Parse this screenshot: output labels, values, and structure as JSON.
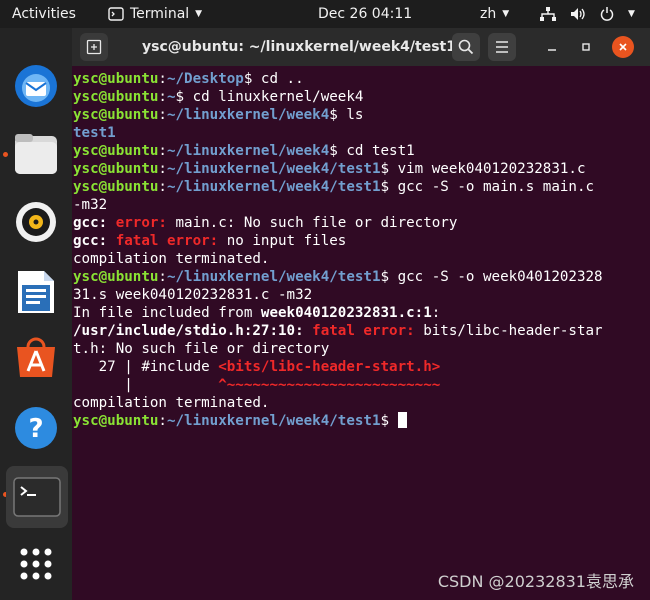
{
  "topbar": {
    "activities": "Activities",
    "app_name": "Terminal",
    "clock": "Dec 26  04:11",
    "lang": "zh"
  },
  "dock": {
    "items": [
      "thunderbird-icon",
      "files-icon",
      "rhythmbox-icon",
      "writer-icon",
      "app-center-icon",
      "help-icon",
      "terminal-icon",
      "app-grid-icon"
    ]
  },
  "window": {
    "title": "ysc@ubuntu: ~/linuxkernel/week4/test1"
  },
  "terminal": {
    "user": "ysc@ubuntu",
    "lines": [
      {
        "path": "~/Desktop",
        "cmd": " cd .."
      },
      {
        "path": "~",
        "cmd": " cd linuxkernel/week4"
      },
      {
        "path": "~/linuxkernel/week4",
        "cmd": " ls"
      },
      {
        "text": "test1"
      },
      {
        "path": "~/linuxkernel/week4",
        "cmd": " cd test1"
      },
      {
        "path": "~/linuxkernel/week4/test1",
        "cmd": " vim week040120232831.c"
      },
      {
        "path": "~/linuxkernel/week4/test1",
        "cmd": " gcc -S -o main.s main.c"
      },
      {
        "text": "-m32"
      },
      {
        "a": "gcc:",
        "b": "error:",
        "c": " main.c: No such file or directory"
      },
      {
        "a": "gcc:",
        "b": "fatal error:",
        "c": " no input files"
      },
      {
        "text": "compilation terminated."
      },
      {
        "path": "~/linuxkernel/week4/test1",
        "cmd": " gcc -S -o week0401202328"
      },
      {
        "text": "31.s week040120232831.c -m32"
      },
      {
        "a": "In file included from ",
        "b": "week040120232831.c:1",
        "c": ":"
      },
      {
        "a": "/usr/include/stdio.h:27:10:",
        "b": "fatal error:",
        "c": " bits/libc-header-star"
      },
      {
        "text": "t.h: No such file or directory"
      },
      {
        "a": "   27 | #include ",
        "b": "<bits/libc-header-start.h>"
      },
      {
        "a": "      |          ",
        "b": "^~~~~~~~~~~~~~~~~~~~~~~~~~"
      },
      {
        "text": "compilation terminated."
      },
      {
        "path": "~/linuxkernel/week4/test1",
        "cmd": " "
      }
    ],
    "sep": ":",
    "dollar": "$"
  },
  "watermark": "CSDN @20232831袁思承"
}
